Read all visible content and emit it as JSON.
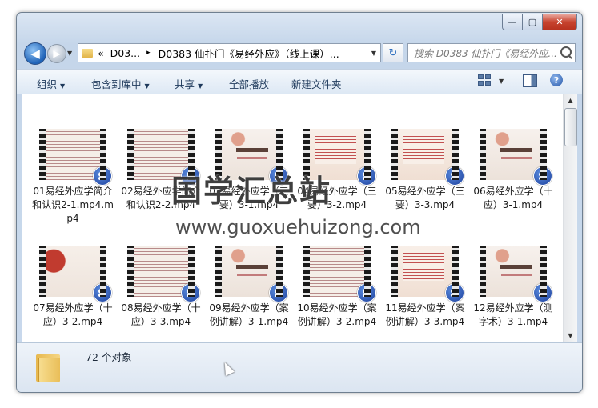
{
  "window": {
    "caption": {
      "min": "—",
      "max": "▢",
      "close": "✕"
    }
  },
  "nav": {
    "back_glyph": "◀",
    "forward_glyph": "▶",
    "address": {
      "prefix": "«",
      "seg1": "D03...",
      "sep": "▸",
      "seg2": "D0383 仙扑门《易经外应》（线上课）..."
    },
    "refresh_glyph": "↻",
    "search_placeholder": "搜索 D0383 仙扑门《易经外应..."
  },
  "toolbar": {
    "organize": "组织",
    "include_in_library": "包含到库中",
    "share": "共享",
    "play_all": "全部播放",
    "new_folder": "新建文件夹",
    "help": "?"
  },
  "files": [
    {
      "name": "01易经外应学简介和认识2-1.mp4.mp4",
      "thumb": "text"
    },
    {
      "name": "02易经外应学简介和认识2-2.mp4",
      "thumb": "text"
    },
    {
      "name": "03易经外应学（三要）3-1.mp4",
      "thumb": "title"
    },
    {
      "name": "04易经外应学（三要）3-2.mp4",
      "thumb": "red"
    },
    {
      "name": "05易经外应学（三要）3-3.mp4",
      "thumb": "red"
    },
    {
      "name": "06易经外应学（十应）3-1.mp4",
      "thumb": "title"
    },
    {
      "name": "07易经外应学（十应）3-2.mp4",
      "thumb": "fan"
    },
    {
      "name": "08易经外应学（十应）3-3.mp4",
      "thumb": "text"
    },
    {
      "name": "09易经外应学（案例讲解）3-1.mp4",
      "thumb": "title"
    },
    {
      "name": "10易经外应学（案例讲解）3-2.mp4",
      "thumb": "text"
    },
    {
      "name": "11易经外应学（案例讲解）3-3.mp4",
      "thumb": "red"
    },
    {
      "name": "12易经外应学（测字术）3-1.mp4",
      "thumb": "title"
    }
  ],
  "status": {
    "count": "72 个对象"
  },
  "watermark": {
    "text": "国学汇总站",
    "url": "www.guoxuehuizong.com"
  },
  "colors": {
    "accent": "#1e395b",
    "frame": "#c5d6ea"
  }
}
